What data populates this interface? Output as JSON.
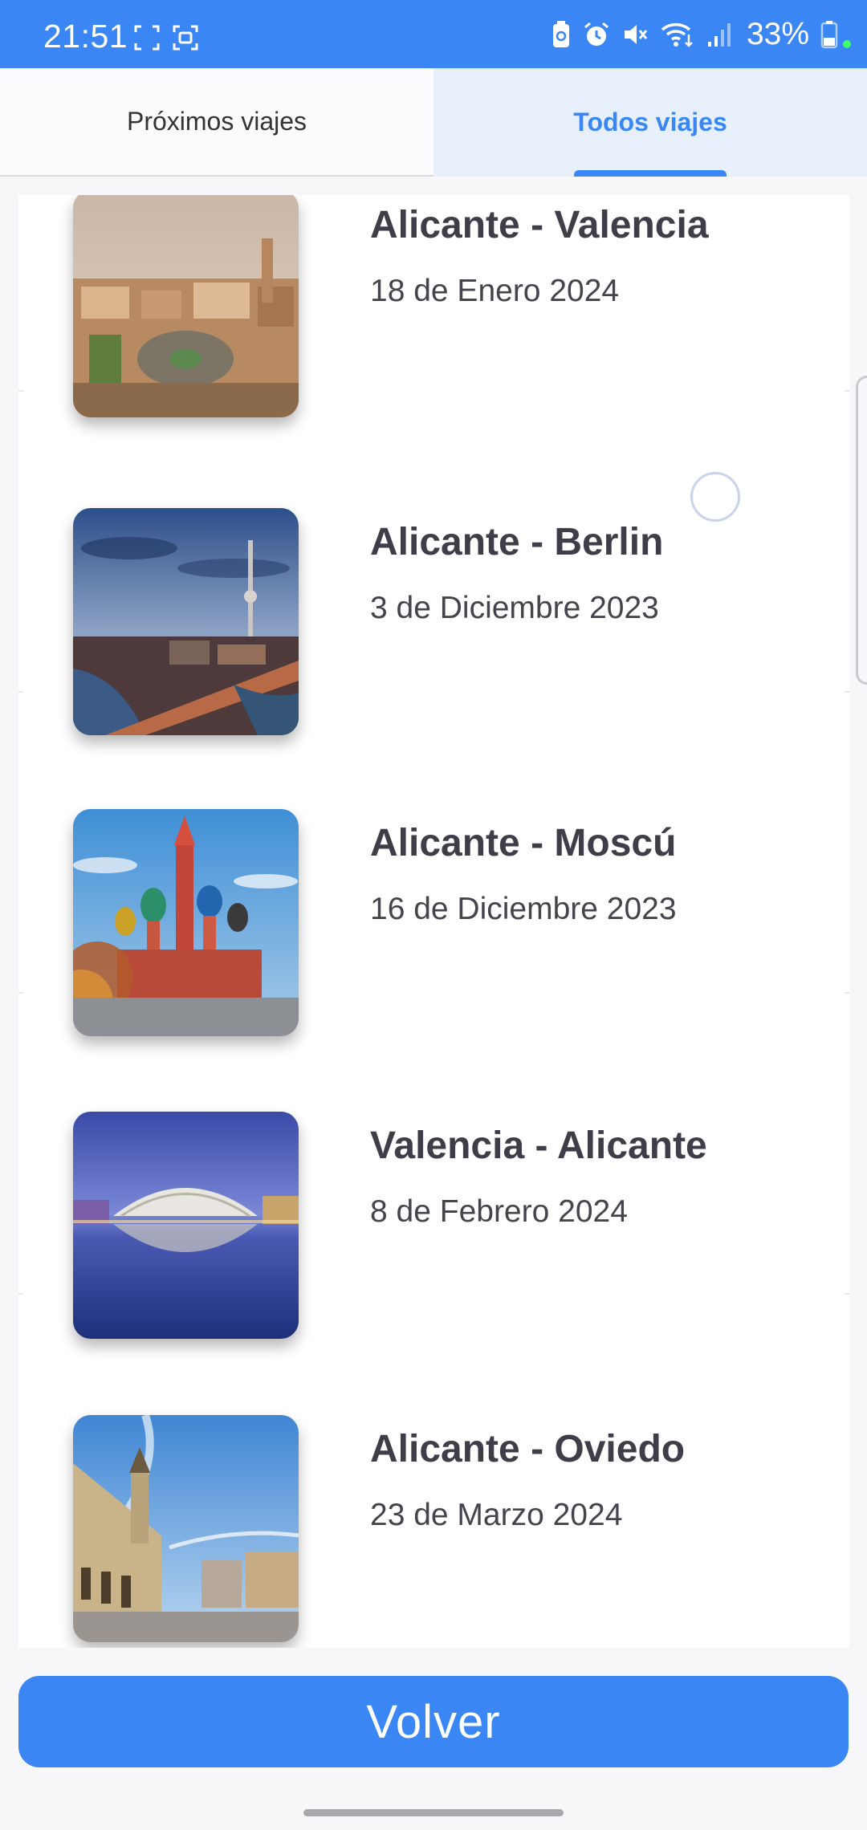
{
  "status_bar": {
    "time": "21:51",
    "battery": "33%",
    "icons": [
      "screenshot-frame-icon",
      "screen-record-icon",
      "battery-saver-icon",
      "alarm-icon",
      "mute-icon",
      "wifi-icon",
      "signal-icon",
      "battery-icon"
    ]
  },
  "tabs": [
    {
      "label": "Próximos viajes",
      "selected": false
    },
    {
      "label": "Todos viajes",
      "selected": true
    }
  ],
  "trips": [
    {
      "title": "Alicante - Valencia",
      "date": "18 de Enero 2024",
      "image": "valencia-city-photo"
    },
    {
      "title": "Alicante - Berlin",
      "date": "3 de Diciembre 2023",
      "image": "berlin-city-photo"
    },
    {
      "title": "Alicante - Moscú",
      "date": "16 de Diciembre 2023",
      "image": "moscow-cathedral-photo"
    },
    {
      "title": "Valencia - Alicante",
      "date": "8 de Febrero 2024",
      "image": "valencia-arts-sciences-photo"
    },
    {
      "title": "Alicante - Oviedo",
      "date": "23 de Marzo 2024",
      "image": "oviedo-square-photo"
    }
  ],
  "back_button_label": "Volver",
  "colors": {
    "accent": "#3a86f5",
    "tab_selected_bg": "#e6effa",
    "title_text": "#3e3e48"
  }
}
